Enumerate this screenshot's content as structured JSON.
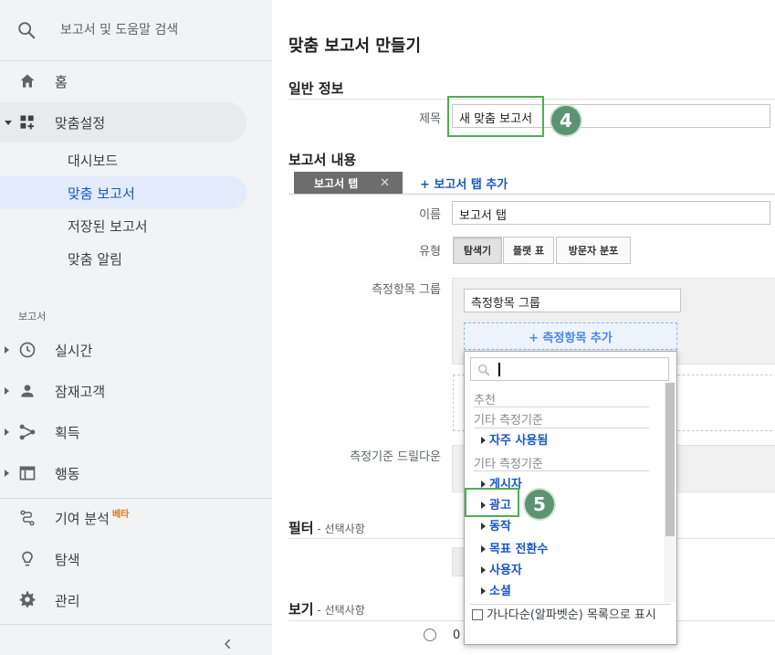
{
  "sidebar": {
    "search_placeholder": "보고서 및 도움말 검색",
    "home": "홈",
    "customization": "맞춤설정",
    "sub_items": [
      "대시보드",
      "맞춤 보고서",
      "저장된 보고서",
      "맞춤 알림"
    ],
    "section_reports": "보고서",
    "reports": [
      "실시간",
      "잠재고객",
      "획득",
      "행동"
    ],
    "attribution": "기여 분석",
    "beta": "베타",
    "discover": "탐색",
    "admin": "관리"
  },
  "main": {
    "page_title": "맞춤 보고서 만들기",
    "general_info": "일반 정보",
    "title_label": "제목",
    "title_value": "새 맞춤 보고서",
    "report_content": "보고서 내용",
    "report_tab": "보고서 탭",
    "add_report_tab": "+ 보고서 탭 추가",
    "name_label": "이름",
    "name_value": "보고서 탭",
    "type_label": "유형",
    "type_options": [
      "탐색기",
      "플랫 표",
      "방문자 분포"
    ],
    "type_selected": "탐색기",
    "metric_group_label": "측정항목 그룹",
    "metric_group_value": "측정항목 그룹",
    "add_metric": "+ 측정항목 추가",
    "dimension_label": "측정기준 드릴다운",
    "filters": "필터",
    "views": "보기",
    "optional": " - 선택사항",
    "radio_value": "0"
  },
  "dropdown": {
    "recommended": "추천",
    "other_metrics": "기타 측정기준",
    "frequently_used": "자주 사용됨",
    "other_metrics2": "기타 측정기준",
    "items": [
      "게시자",
      "광고",
      "동작",
      "목표 전환수",
      "사용자",
      "소셜"
    ],
    "footer": "가나다순(알파벳순) 목록으로 표시"
  },
  "badges": [
    "4",
    "5"
  ],
  "colors": {
    "accent": "#1a56c4",
    "highlight": "#4caf50",
    "badge": "#5c9373"
  }
}
